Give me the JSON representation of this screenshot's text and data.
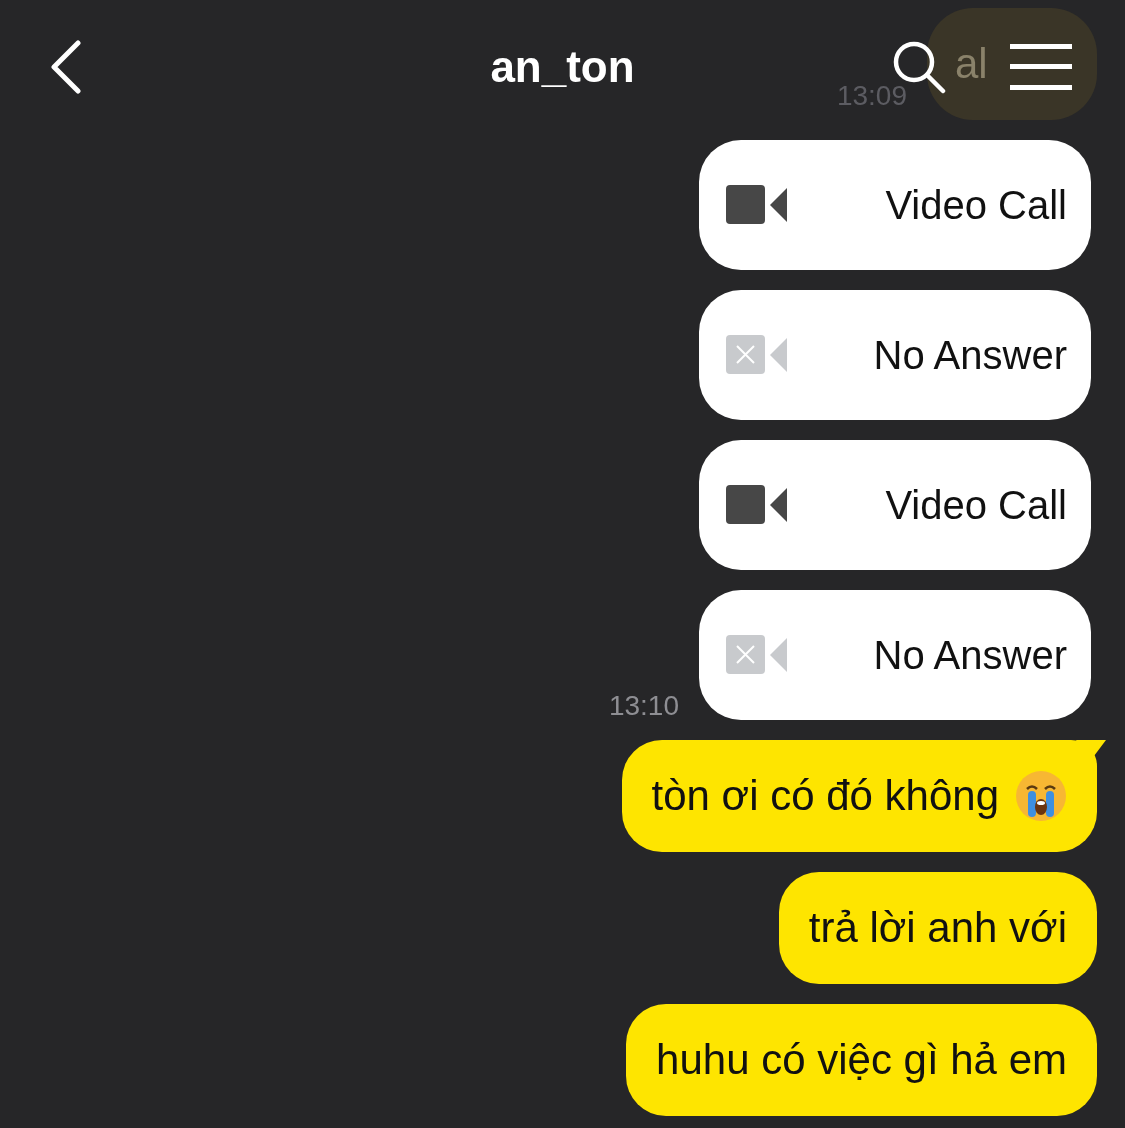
{
  "header": {
    "title": "an_ton"
  },
  "messages": [
    {
      "kind": "text",
      "text": "al",
      "faded": true,
      "time": "13:09"
    },
    {
      "kind": "call",
      "label": "Video Call",
      "missed": false
    },
    {
      "kind": "call",
      "label": "No Answer",
      "missed": true
    },
    {
      "kind": "call",
      "label": "Video Call",
      "missed": false
    },
    {
      "kind": "call",
      "label": "No Answer",
      "missed": true,
      "time": "13:10"
    },
    {
      "kind": "text",
      "text": "tòn ơi có đó không",
      "faded": false,
      "tail": true,
      "emoji": true
    },
    {
      "kind": "text",
      "text": "trả lời anh với",
      "faded": false
    },
    {
      "kind": "text",
      "text": "huhu có việc gì hả em",
      "faded": false
    }
  ]
}
